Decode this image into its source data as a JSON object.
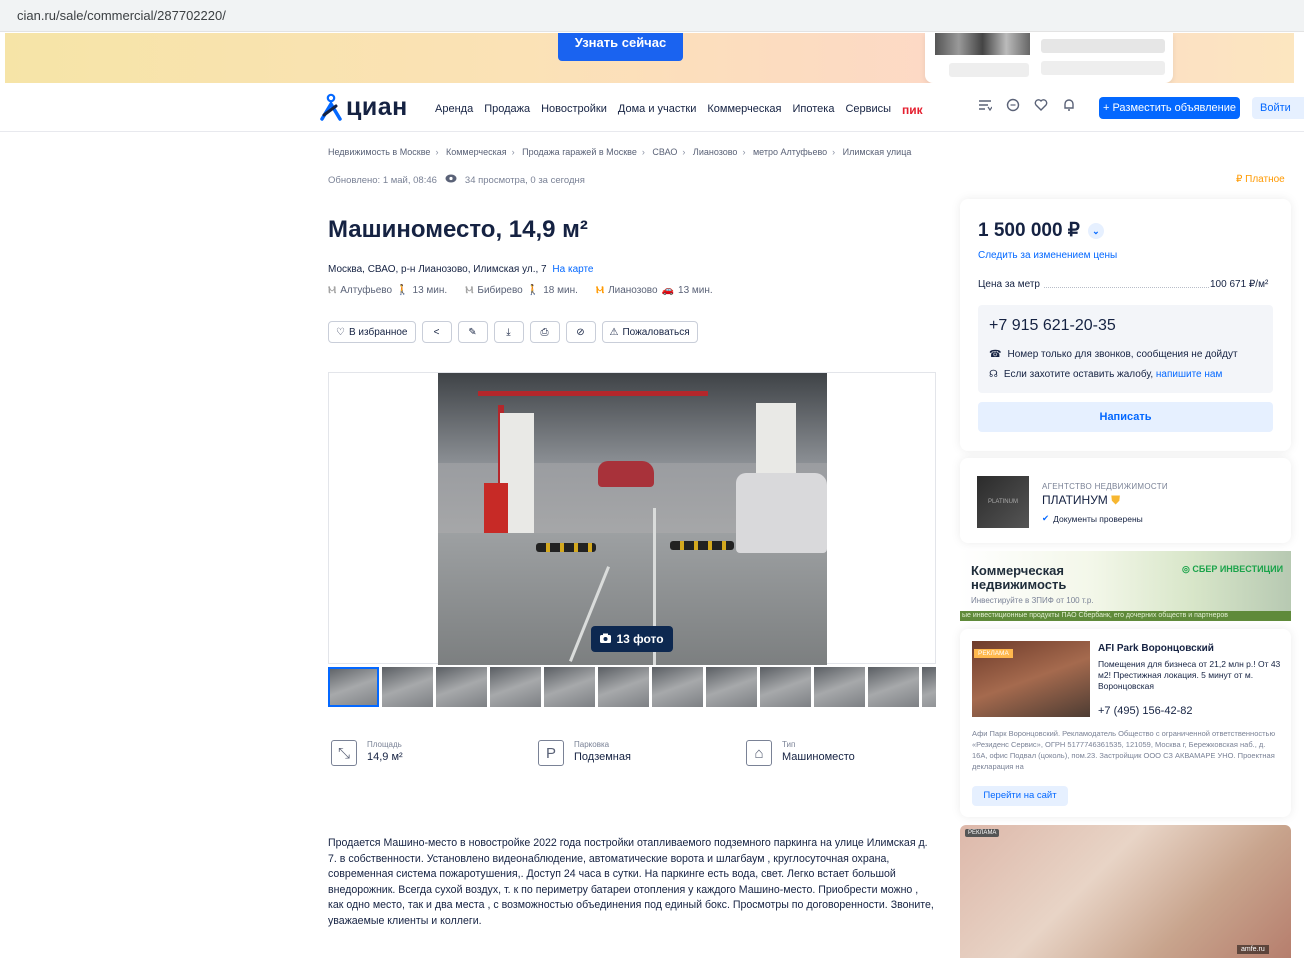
{
  "browser": {
    "url": "cian.ru/sale/commercial/287702220/"
  },
  "banner": {
    "button_label": "Узнать сейчас"
  },
  "header": {
    "logo": "циан",
    "nav": [
      "Аренда",
      "Продажа",
      "Новостройки",
      "Дома и участки",
      "Коммерческая",
      "Ипотека",
      "Сервисы"
    ],
    "pik": "пик",
    "icons": [
      "compare-icon",
      "chat-icon",
      "heart-icon",
      "bell-icon"
    ],
    "post_button": "+ Разместить объявление",
    "login_button": "Войти"
  },
  "breadcrumbs": [
    "Недвижимость в Москве",
    "Коммерческая",
    "Продажа гаражей в Москве",
    "СВАО",
    "Лианозово",
    "метро Алтуфьево",
    "Илимская улица"
  ],
  "meta": {
    "updated": "Обновлено: 1 май, 08:46",
    "views": "34 просмотра, 0 за сегодня",
    "paid": "₽ Платное"
  },
  "listing": {
    "title": "Машиноместо, 14,9 м²",
    "address": "Москва, СВАО, р-н Лианозово, Илимская ул., 7",
    "map_link": "На карте",
    "metro": [
      {
        "name": "Алтуфьево",
        "time": "13 мин.",
        "mode": "walk",
        "color": "#a3a3a3"
      },
      {
        "name": "Бибирево",
        "time": "18 мин.",
        "mode": "walk",
        "color": "#a3a3a3"
      },
      {
        "name": "Лианозово",
        "time": "13 мин.",
        "mode": "car",
        "color": "#ff9900"
      }
    ]
  },
  "actions": {
    "favorite": "В избранное",
    "report": "Пожаловаться"
  },
  "gallery": {
    "photo_count": "13 фото",
    "thumbnail_count": 11
  },
  "features": [
    {
      "label": "Площадь",
      "value": "14,9 м²",
      "icon": "area-icon"
    },
    {
      "label": "Парковка",
      "value": "Подземная",
      "icon": "parking-icon"
    },
    {
      "label": "Тип",
      "value": "Машиноместо",
      "icon": "garage-icon"
    }
  ],
  "description": "Продается Машино-место в новостройке 2022 года постройки отапливаемого подземного паркинга  на улице Илимская д. 7. в собственности.  Установлено видеонаблюдение, автоматические ворота и шлагбаум , круглосуточная охрана, современная система пожаротушения,. Доступ 24 часа в сутки. На паркинге есть вода, свет. Легко встает большой внедорожник. Всегда сухой воздух, т. к по периметру батареи отопления у каждого Машино-место.  Приобрести можно , как одно место, так и два места , с возможностью объединения под единый бокс. Просмотры по договоренности. Звоните, уважаемые клиенты и коллеги.",
  "price_card": {
    "price": "1 500 000 ₽",
    "follow": "Следить за изменением цены",
    "price_per_meter_label": "Цена за метр",
    "price_per_meter": "100 671 ₽/м²",
    "phone": "+7 915 621-20-35",
    "note_calls": "Номер только для звонков, сообщения не дойдут",
    "note_complaint": "Если захотите оставить жалобу,",
    "note_complaint_link": "напишите нам",
    "write_button": "Написать"
  },
  "agency": {
    "type": "АГЕНТСТВО НЕДВИЖИМОСТИ",
    "name": "ПЛАТИНУМ",
    "verified": "Документы проверены",
    "logo_text": "PLATINUM"
  },
  "sber_ad": {
    "title": "Коммерческая недвижимость",
    "subtitle": "Инвестируйте в ЗПИФ от 100 т.р.",
    "brand": "◎ СБЕР ИНВЕСТИЦИИ",
    "strip": "ые инвестиционные продукты ПАО Сбербанк, его дочерних обществ и партнеров"
  },
  "afi_ad": {
    "badge": "РЕКЛАМА",
    "name": "AFI Park Воронцовский",
    "text": "Помещения для бизнеса от 21,2 млн р.! От 43 м2! Престижная локация. 5 минут от м. Воронцовская",
    "phone": "+7 (495) 156-42-82",
    "legal": "Афи Парк Воронцовский. Рекламодатель Общество с ограниченной ответственностью «Резиденс Сервис», ОГРН 5177746361535, 121059, Москва г, Бережковская наб., д. 16А, офис Подвал (цоколь), пом.23. Застройщик ООО СЗ АКВАМАРЕ УНО. Проектная декларация на",
    "button": "Перейти на сайт"
  },
  "bottom_ad": {
    "badge": "РЕКЛАМА",
    "brand": "amfe.ru"
  }
}
